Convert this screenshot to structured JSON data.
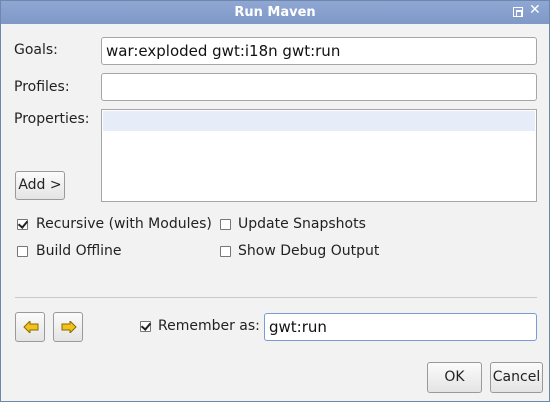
{
  "window": {
    "title": "Run Maven"
  },
  "goals": {
    "label": "Goals:",
    "value": "war:exploded gwt:i18n gwt:run"
  },
  "profiles": {
    "label": "Profiles:",
    "value": ""
  },
  "properties": {
    "label": "Properties:",
    "add_label": "Add >"
  },
  "options": {
    "recursive": {
      "label": "Recursive (with Modules)",
      "checked": true
    },
    "update_snapshots": {
      "label": "Update Snapshots",
      "checked": false
    },
    "build_offline": {
      "label": "Build Offline",
      "checked": false
    },
    "show_debug": {
      "label": "Show Debug Output",
      "checked": false
    }
  },
  "remember": {
    "label": "Remember as:",
    "checked": true,
    "value": "gwt:run"
  },
  "buttons": {
    "ok": "OK",
    "cancel": "Cancel"
  },
  "colors": {
    "titlebar": "#8fa7d3",
    "arrow": "#f2c21b"
  }
}
